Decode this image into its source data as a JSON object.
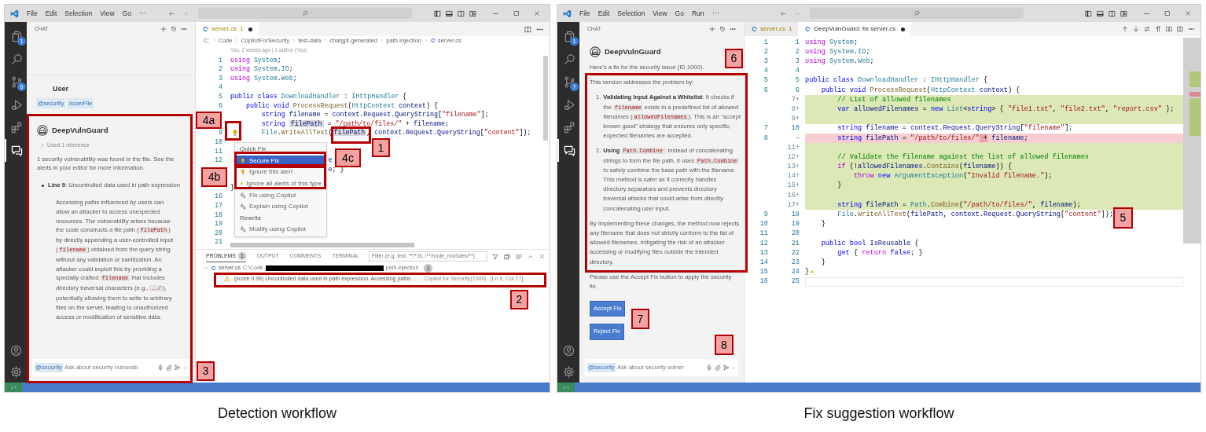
{
  "screenshots": [
    {
      "kind": "detection",
      "caption": "Detection workflow",
      "menu": [
        "File",
        "Edit",
        "Selection",
        "View",
        "Go",
        "⋯"
      ],
      "activity_bar": [
        {
          "selected": false,
          "badge": "1"
        },
        {
          "selected": false
        },
        {
          "selected": false,
          "badge": "6"
        },
        {
          "selected": false
        },
        {
          "selected": false
        },
        {
          "selected": true
        }
      ],
      "chat": {
        "title": "CHAT",
        "messages": [
          {
            "kind": "user",
            "author": "User",
            "chips": [
              "@security",
              "/scanFile"
            ]
          },
          {
            "kind": "bot",
            "author": "DeepVulnGuard",
            "reference": "Used 1 reference",
            "blocks": [
              {
                "kind": "paragraph",
                "segments": [
                  {
                    "kind": "text",
                    "text": "1 security vulnerability was found in the file. See the alerts in your editor for more information."
                  }
                ]
              },
              {
                "kind": "bullet",
                "segments": [
                  {
                    "kind": "bold",
                    "text": "Line 9"
                  },
                  {
                    "kind": "text",
                    "text": ": Uncontrolled data used in path expression"
                  }
                ]
              },
              {
                "kind": "indented",
                "segments": [
                  {
                    "kind": "text",
                    "text": "Accessing paths influenced by users can allow an attacker to access unexpected resources. The vulnerability arises because the code constructs a file path ("
                  },
                  {
                    "kind": "code",
                    "text": "filePath"
                  },
                  {
                    "kind": "text",
                    "text": ") by directly appending a user-controlled input ("
                  },
                  {
                    "kind": "code",
                    "text": "filename"
                  },
                  {
                    "kind": "text",
                    "text": ") obtained from the query string without any validation or sanitization. An attacker could exploit this by providing a specially crafted "
                  },
                  {
                    "kind": "code",
                    "text": "filename"
                  },
                  {
                    "kind": "text",
                    "text": " that includes directory traversal characters (e.g., "
                  },
                  {
                    "kind": "code",
                    "text": "../"
                  },
                  {
                    "kind": "text",
                    "text": "), potentially allowing them to write to arbitrary files on the server, leading to unauthorized access or modification of sensitive data."
                  }
                ]
              }
            ]
          }
        ],
        "input": {
          "chip": "@security",
          "placeholder": "Ask about security vulnerab"
        }
      },
      "editor": {
        "tabs": [
          {
            "label": "server.cs",
            "count": "1",
            "modified": true,
            "selected": true
          }
        ],
        "breadcrumb": [
          "C:",
          "Code",
          "CopilotForSecurity",
          "test-data",
          "chatgpt-generated",
          "path-injection",
          "server.cs"
        ],
        "blame": "You, 2 weeks ago | 1 author (You)",
        "lines": [
          {
            "number": "1",
            "tokens": [
              {
                "kind": "ctrl",
                "text": "using"
              },
              {
                "kind": "type",
                "text": " System"
              },
              {
                "kind": "p",
                "text": ";"
              }
            ]
          },
          {
            "number": "2",
            "tokens": [
              {
                "kind": "ctrl",
                "text": "using"
              },
              {
                "kind": "type",
                "text": " System"
              },
              {
                "kind": "p",
                "text": "."
              },
              {
                "kind": "type",
                "text": "IO"
              },
              {
                "kind": "p",
                "text": ";"
              }
            ]
          },
          {
            "number": "3",
            "tokens": [
              {
                "kind": "ctrl",
                "text": "using"
              },
              {
                "kind": "type",
                "text": " System"
              },
              {
                "kind": "p",
                "text": "."
              },
              {
                "kind": "type",
                "text": "Web"
              },
              {
                "kind": "p",
                "text": ";"
              }
            ]
          },
          {
            "number": "4"
          },
          {
            "number": "5",
            "tokens": [
              {
                "kind": "kw",
                "text": "public"
              },
              {
                "kind": "kw",
                "text": " class"
              },
              {
                "kind": "type",
                "text": " DownloadHandler"
              },
              {
                "kind": "p",
                "text": " : "
              },
              {
                "kind": "type",
                "text": "IHttpHandler"
              },
              {
                "kind": "p",
                "text": " {"
              }
            ]
          },
          {
            "number": "6",
            "tokens": [
              {
                "kind": "kw",
                "text": "    public"
              },
              {
                "kind": "kw",
                "text": " void"
              },
              {
                "kind": "fn",
                "text": " ProcessRequest"
              },
              {
                "kind": "p",
                "text": "("
              },
              {
                "kind": "type",
                "text": "HttpContext"
              },
              {
                "kind": "var",
                "text": " context"
              },
              {
                "kind": "p",
                "text": ") {"
              }
            ]
          },
          {
            "tokens": [
              {
                "kind": "kw",
                "text": "        string"
              },
              {
                "kind": "var",
                "text": " filename"
              },
              {
                "kind": "p",
                "text": " = "
              },
              {
                "kind": "var",
                "text": "context"
              },
              {
                "kind": "p",
                "text": "."
              },
              {
                "kind": "var",
                "text": "Request"
              },
              {
                "kind": "p",
                "text": "."
              },
              {
                "kind": "var",
                "text": "QueryString"
              },
              {
                "kind": "p",
                "text": "["
              },
              {
                "kind": "str",
                "text": "\"filename\""
              },
              {
                "kind": "p",
                "text": "];"
              }
            ]
          },
          {
            "tokens": [
              {
                "kind": "kw",
                "text": "        string "
              },
              {
                "kind": "var",
                "text": "filePath",
                "marked": true
              },
              {
                "kind": "p",
                "text": " = "
              },
              {
                "kind": "str",
                "text": "\"/path/to/files/\""
              },
              {
                "kind": "p",
                "text": " + "
              },
              {
                "kind": "var",
                "text": "filename"
              },
              {
                "kind": "p",
                "text": ";"
              }
            ]
          },
          {
            "number": "9",
            "lightbulb": true,
            "tokens": [
              {
                "kind": "type",
                "text": "        File"
              },
              {
                "kind": "p",
                "text": "."
              },
              {
                "kind": "fn",
                "text": "WriteAllText"
              },
              {
                "kind": "p",
                "text": "("
              },
              {
                "kind": "var",
                "text": "filePath",
                "marked": true
              },
              {
                "kind": "p",
                "text": ", "
              },
              {
                "kind": "var",
                "text": "context"
              },
              {
                "kind": "p",
                "text": "."
              },
              {
                "kind": "var",
                "text": "Request"
              },
              {
                "kind": "p",
                "text": "."
              },
              {
                "kind": "var",
                "text": "QueryString"
              },
              {
                "kind": "p",
                "text": "["
              },
              {
                "kind": "str",
                "text": "\"content\""
              },
              {
                "kind": "p",
                "text": "]);"
              }
            ]
          },
          {
            "number": "10"
          },
          {
            "number": "11"
          },
          {
            "number": "12",
            "tokens": [
              {
                "kind": "var",
                "text": "                         e"
              }
            ]
          },
          {
            "tokens": [
              {
                "kind": "var",
                "text": "                         e"
              },
              {
                "kind": "p",
                "text": "; }"
              }
            ]
          },
          {
            "covered": true
          },
          {
            "tokens": [
              {
                "kind": "p",
                "text": "}"
              }
            ]
          },
          {
            "number": "16"
          },
          {
            "number": "17"
          },
          {
            "number": "18"
          },
          {
            "number": "19"
          },
          {
            "number": "20"
          },
          {
            "number": "21"
          }
        ],
        "quick_fix": {
          "title": "Quick Fix",
          "items": [
            {
              "kind": "bulb",
              "label": "Secure Fix",
              "selected": true
            },
            {
              "kind": "bulb",
              "label": "Ignore this alert",
              "selected": false
            },
            {
              "kind": "bulb",
              "label": "Ignore all alerts of this type",
              "selected": false
            },
            {
              "kind": "sparkle",
              "label": "Fix using Copilot",
              "selected": false
            },
            {
              "kind": "sparkle",
              "label": "Explain using Copilot",
              "selected": false
            },
            {
              "kind": "section",
              "label": "Rewrite"
            },
            {
              "kind": "sparkle",
              "label": "Modify using Copilot",
              "selected": false
            }
          ]
        }
      },
      "panel": {
        "tabs": [
          {
            "label": "PROBLEMS",
            "badge": "1",
            "selected": true
          },
          {
            "label": "OUTPUT",
            "selected": false
          },
          {
            "label": "COMMENTS",
            "selected": false
          },
          {
            "label": "TERMINAL",
            "selected": false
          }
        ],
        "filter_placeholder": "Filter (e.g. text, **/*.ts, !**/node_modules/**)",
        "file": {
          "name": "server.cs",
          "path_start": "C:\\Code",
          "path_end": "path-injection",
          "count": "1",
          "redacted": true,
          "expanded": true
        },
        "problems": [
          {
            "message": "(score 0.99) Uncontrolled data used in path expression. Accessing paths ...",
            "source": "Copilot for Security(1000)",
            "location": "[Ln 9, Col 27]"
          }
        ]
      },
      "callouts": [
        {
          "label": "4a"
        },
        {
          "label": "4c"
        },
        {
          "label": "1"
        },
        {
          "label": "4b"
        },
        {
          "label": "2"
        },
        {
          "label": "3"
        }
      ]
    },
    {
      "kind": "fix",
      "caption": "Fix suggestion workflow",
      "menu": [
        "File",
        "Edit",
        "Selection",
        "View",
        "Go",
        "Run",
        "⋯"
      ],
      "activity_bar": [
        {
          "selected": false,
          "badge": "1"
        },
        {
          "selected": false
        },
        {
          "selected": false,
          "badge": "7"
        },
        {
          "selected": false
        },
        {
          "selected": false
        },
        {
          "selected": true
        }
      ],
      "chat": {
        "title": "CHAT",
        "messages": [
          {
            "kind": "bot",
            "author": "DeepVulnGuard",
            "blocks": [
              {
                "kind": "paragraph",
                "segments": [
                  {
                    "kind": "text",
                    "text": "Here's a fix for the security issue (ID 1000)."
                  }
                ]
              },
              {
                "kind": "paragraph",
                "segments": [
                  {
                    "kind": "text",
                    "text": "This version addresses the problem by:"
                  }
                ]
              },
              {
                "kind": "numbered",
                "number": "1.",
                "segments": [
                  {
                    "kind": "bold",
                    "text": "Validating Input Against a Whitelist"
                  },
                  {
                    "kind": "text",
                    "text": ": It checks if the "
                  },
                  {
                    "kind": "code",
                    "text": "filename"
                  },
                  {
                    "kind": "text",
                    "text": " exists in a predefined list of allowed filenames ("
                  },
                  {
                    "kind": "code",
                    "text": "allowedFilenames"
                  },
                  {
                    "kind": "text",
                    "text": "). This is an \"accept known good\" strategy that ensures only specific, expected filenames are accepted."
                  }
                ]
              },
              {
                "kind": "numbered",
                "number": "2.",
                "segments": [
                  {
                    "kind": "bold",
                    "text": "Using "
                  },
                  {
                    "kind": "code",
                    "text": "Path.Combine"
                  },
                  {
                    "kind": "text",
                    "text": ": Instead of concatenating strings to form the file path, it uses "
                  },
                  {
                    "kind": "code",
                    "text": "Path.Combine"
                  },
                  {
                    "kind": "text",
                    "text": " to safely combine the base path with the filename. This method is safer as it correctly handles directory separators and prevents directory traversal attacks that could arise from directly concatenating user input."
                  }
                ]
              },
              {
                "kind": "paragraph",
                "segments": [
                  {
                    "kind": "text",
                    "text": "By implementing these changes, the method now rejects any filename that does not strictly conform to the list of allowed filenames, mitigating the risk of an attacker accessing or modifying files outside the intended directory."
                  }
                ]
              },
              {
                "kind": "paragraph",
                "segments": [
                  {
                    "kind": "text",
                    "text": "Please use the Accept Fix button to apply the security fix."
                  }
                ]
              },
              {
                "kind": "buttons",
                "labels": [
                  "Accept Fix",
                  "Reject Fix"
                ]
              }
            ]
          }
        ],
        "input": {
          "chip": "@security",
          "placeholder": "Ask about security vulner"
        }
      },
      "editor": {
        "tabs": [
          {
            "label": "server.cs",
            "count": "1",
            "modified": false,
            "selected": false
          },
          {
            "label": "DeepVulnGuard: fix server.cs",
            "modified": true,
            "selected": true
          }
        ],
        "diff": [
          {
            "old": "1",
            "new": "1",
            "kind": "context",
            "tokens": [
              {
                "kind": "ctrl",
                "text": "using"
              },
              {
                "kind": "type",
                "text": " System"
              },
              {
                "kind": "p",
                "text": ";"
              }
            ]
          },
          {
            "old": "2",
            "new": "2",
            "kind": "context",
            "tokens": [
              {
                "kind": "ctrl",
                "text": "using"
              },
              {
                "kind": "type",
                "text": " System"
              },
              {
                "kind": "p",
                "text": "."
              },
              {
                "kind": "type",
                "text": "IO"
              },
              {
                "kind": "p",
                "text": ";"
              }
            ]
          },
          {
            "old": "3",
            "new": "3",
            "kind": "context",
            "tokens": [
              {
                "kind": "ctrl",
                "text": "using"
              },
              {
                "kind": "type",
                "text": " System"
              },
              {
                "kind": "p",
                "text": "."
              },
              {
                "kind": "type",
                "text": "Web"
              },
              {
                "kind": "p",
                "text": ";"
              }
            ]
          },
          {
            "old": "4",
            "new": "4",
            "kind": "context"
          },
          {
            "old": "5",
            "new": "5",
            "kind": "context",
            "tokens": [
              {
                "kind": "kw",
                "text": "public"
              },
              {
                "kind": "kw",
                "text": " class"
              },
              {
                "kind": "type",
                "text": " DownloadHandler"
              },
              {
                "kind": "p",
                "text": " : "
              },
              {
                "kind": "type",
                "text": "IHttpHandler"
              },
              {
                "kind": "p",
                "text": " {"
              }
            ]
          },
          {
            "old": "6",
            "new": "6",
            "kind": "context",
            "tokens": [
              {
                "kind": "kw",
                "text": "    public"
              },
              {
                "kind": "kw",
                "text": " void"
              },
              {
                "kind": "fn",
                "text": " ProcessRequest"
              },
              {
                "kind": "p",
                "text": "("
              },
              {
                "kind": "type",
                "text": "HttpContext"
              },
              {
                "kind": "var",
                "text": " context"
              },
              {
                "kind": "p",
                "text": ") {"
              }
            ]
          },
          {
            "new": "7+",
            "kind": "added",
            "tokens": [
              {
                "kind": "com",
                "text": "        // List of allowed filenames"
              }
            ]
          },
          {
            "new": "8+",
            "kind": "added",
            "tokens": [
              {
                "kind": "kw",
                "text": "        var"
              },
              {
                "kind": "var",
                "text": " allowedFilenames"
              },
              {
                "kind": "p",
                "text": " = "
              },
              {
                "kind": "kw",
                "text": "new"
              },
              {
                "kind": "type",
                "text": " List"
              },
              {
                "kind": "p",
                "text": "<"
              },
              {
                "kind": "kw",
                "text": "string"
              },
              {
                "kind": "p",
                "text": "> { "
              },
              {
                "kind": "str",
                "text": "\"file1.txt\""
              },
              {
                "kind": "p",
                "text": ", "
              },
              {
                "kind": "str",
                "text": "\"file2.txt\""
              },
              {
                "kind": "p",
                "text": ", "
              },
              {
                "kind": "str",
                "text": "\"report.csv\""
              },
              {
                "kind": "p",
                "text": " };"
              }
            ]
          },
          {
            "new": "9+",
            "kind": "added"
          },
          {
            "old": "7",
            "new": "10",
            "kind": "context",
            "tokens": [
              {
                "kind": "kw",
                "text": "        string"
              },
              {
                "kind": "var",
                "text": " filename"
              },
              {
                "kind": "p",
                "text": " = "
              },
              {
                "kind": "var",
                "text": "context"
              },
              {
                "kind": "p",
                "text": "."
              },
              {
                "kind": "var",
                "text": "Request"
              },
              {
                "kind": "p",
                "text": "."
              },
              {
                "kind": "var",
                "text": "QueryString"
              },
              {
                "kind": "p",
                "text": "["
              },
              {
                "kind": "str",
                "text": "\"filename\""
              },
              {
                "kind": "p",
                "text": "];"
              }
            ]
          },
          {
            "old": "8",
            "new": "—",
            "kind": "removed",
            "tokens": [
              {
                "kind": "kw",
                "text": "        string"
              },
              {
                "kind": "var",
                "text": " filePath"
              },
              {
                "kind": "p",
                "text": " = "
              },
              {
                "kind": "str",
                "text": "\"/path/to/files/\""
              },
              {
                "kind": "p",
                "text": " +",
                "marked": true
              },
              {
                "kind": "var",
                "text": " filename"
              },
              {
                "kind": "p",
                "text": ";"
              }
            ]
          },
          {
            "new": "11+",
            "kind": "added"
          },
          {
            "new": "12+",
            "kind": "added",
            "tokens": [
              {
                "kind": "com",
                "text": "        // Validate the filename against the list of allowed filenames"
              }
            ]
          },
          {
            "new": "13+",
            "kind": "added",
            "tokens": [
              {
                "kind": "ctrl",
                "text": "        if"
              },
              {
                "kind": "p",
                "text": " (!"
              },
              {
                "kind": "var",
                "text": "allowedFilenames"
              },
              {
                "kind": "p",
                "text": "."
              },
              {
                "kind": "fn",
                "text": "Contains"
              },
              {
                "kind": "p",
                "text": "("
              },
              {
                "kind": "var",
                "text": "filename"
              },
              {
                "kind": "p",
                "text": ")) {"
              }
            ]
          },
          {
            "new": "14+",
            "kind": "added",
            "tokens": [
              {
                "kind": "ctrl",
                "text": "            throw"
              },
              {
                "kind": "kw",
                "text": " new"
              },
              {
                "kind": "type",
                "text": " ArgumentException"
              },
              {
                "kind": "p",
                "text": "("
              },
              {
                "kind": "str",
                "text": "\"Invalid filename.\""
              },
              {
                "kind": "p",
                "text": ");"
              }
            ]
          },
          {
            "new": "15+",
            "kind": "added",
            "tokens": [
              {
                "kind": "p",
                "text": "        }"
              }
            ]
          },
          {
            "new": "16+",
            "kind": "added"
          },
          {
            "new": "17+",
            "kind": "added",
            "tokens": [
              {
                "kind": "kw",
                "text": "        string"
              },
              {
                "kind": "var",
                "text": " filePath"
              },
              {
                "kind": "p",
                "text": " = "
              },
              {
                "kind": "type",
                "text": "Path"
              },
              {
                "kind": "p",
                "text": "."
              },
              {
                "kind": "fn",
                "text": "Combine"
              },
              {
                "kind": "p",
                "text": "("
              },
              {
                "kind": "str",
                "text": "\"/path/to/files/\""
              },
              {
                "kind": "p",
                "text": ", "
              },
              {
                "kind": "var",
                "text": "filename"
              },
              {
                "kind": "p",
                "text": ");"
              }
            ]
          },
          {
            "old": "9",
            "new": "18",
            "kind": "context",
            "tokens": [
              {
                "kind": "type",
                "text": "        File"
              },
              {
                "kind": "p",
                "text": "."
              },
              {
                "kind": "fn",
                "text": "WriteAllText"
              },
              {
                "kind": "p",
                "text": "("
              },
              {
                "kind": "var",
                "text": "filePath"
              },
              {
                "kind": "p",
                "text": ", "
              },
              {
                "kind": "var",
                "text": "context"
              },
              {
                "kind": "p",
                "text": "."
              },
              {
                "kind": "var",
                "text": "Request"
              },
              {
                "kind": "p",
                "text": "."
              },
              {
                "kind": "var",
                "text": "QueryString"
              },
              {
                "kind": "p",
                "text": "["
              },
              {
                "kind": "str",
                "text": "\"content\""
              },
              {
                "kind": "p",
                "text": "]);"
              }
            ]
          },
          {
            "old": "10",
            "new": "19",
            "kind": "context",
            "tokens": [
              {
                "kind": "p",
                "text": "    }"
              }
            ]
          },
          {
            "old": "11",
            "new": "20",
            "kind": "context"
          },
          {
            "old": "12",
            "new": "21",
            "kind": "context",
            "tokens": [
              {
                "kind": "kw",
                "text": "    public"
              },
              {
                "kind": "kw",
                "text": " bool"
              },
              {
                "kind": "var",
                "text": " IsReusable"
              },
              {
                "kind": "p",
                "text": " {"
              }
            ]
          },
          {
            "old": "13",
            "new": "22",
            "kind": "context",
            "tokens": [
              {
                "kind": "kw",
                "text": "        get"
              },
              {
                "kind": "p",
                "text": " { "
              },
              {
                "kind": "ctrl",
                "text": "return"
              },
              {
                "kind": "kw",
                "text": " false"
              },
              {
                "kind": "p",
                "text": "; }"
              }
            ]
          },
          {
            "old": "14",
            "new": "23",
            "kind": "context",
            "tokens": [
              {
                "kind": "p",
                "text": "    }"
              }
            ]
          },
          {
            "old": "15",
            "new": "24",
            "kind": "context",
            "ai_marker": true,
            "tokens": [
              {
                "kind": "p",
                "text": "}"
              }
            ]
          },
          {
            "old": "16",
            "new": "25",
            "kind": "context",
            "current": true
          }
        ]
      },
      "callouts": [
        {
          "label": "6"
        },
        {
          "label": "5"
        },
        {
          "label": "7"
        },
        {
          "label": "8"
        }
      ]
    }
  ]
}
